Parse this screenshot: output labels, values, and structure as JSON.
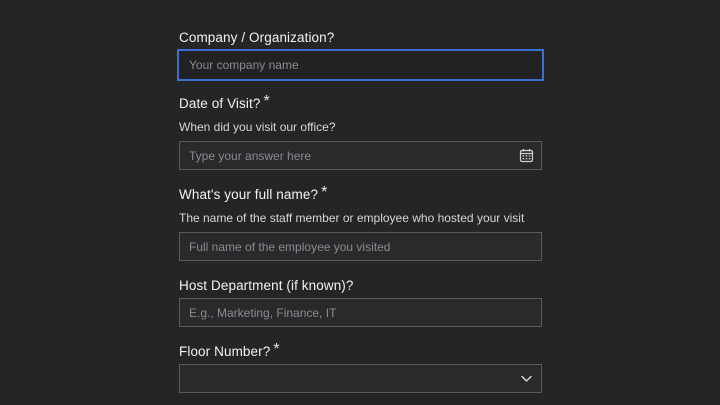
{
  "form": {
    "company": {
      "label": "Company / Organization?",
      "placeholder": "Your company name"
    },
    "visit_date": {
      "label": "Date of Visit?",
      "required_mark": "*",
      "help": "When did you visit our office?",
      "placeholder": "Type your answer here",
      "icon": "calendar-icon"
    },
    "full_name": {
      "label": "What's your full name?",
      "required_mark": "*",
      "help": "The name of the staff member or employee who hosted your visit",
      "placeholder": "Full name of the employee you visited"
    },
    "department": {
      "label": "Host Department (if known)?",
      "placeholder": "E.g., Marketing, Finance, IT"
    },
    "floor": {
      "label": "Floor Number?",
      "required_mark": "*",
      "value": "",
      "icon": "chevron-down-icon"
    }
  },
  "colors": {
    "background": "#252527",
    "focus_border": "#3c6fd1",
    "field_border": "#5b5b5f",
    "text": "#e9e9ea",
    "placeholder": "#8b8b90"
  }
}
